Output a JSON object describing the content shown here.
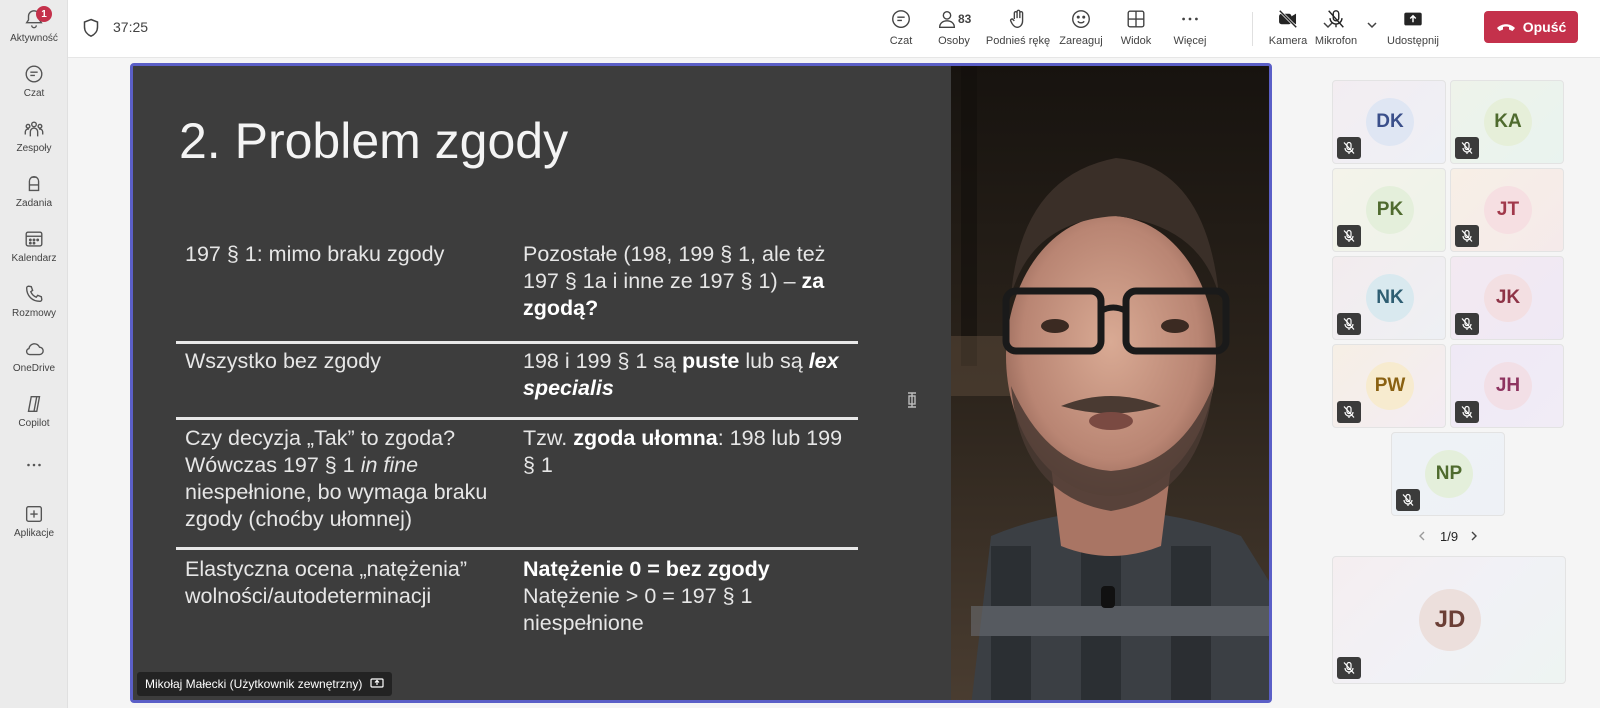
{
  "rail": {
    "items": [
      {
        "label": "Aktywność",
        "icon": "bell-icon",
        "badge": "1"
      },
      {
        "label": "Czat",
        "icon": "chat-icon"
      },
      {
        "label": "Zespoły",
        "icon": "teams-icon"
      },
      {
        "label": "Zadania",
        "icon": "tasks-icon"
      },
      {
        "label": "Kalendarz",
        "icon": "calendar-icon"
      },
      {
        "label": "Rozmowy",
        "icon": "phone-icon"
      },
      {
        "label": "OneDrive",
        "icon": "cloud-icon"
      },
      {
        "label": "Copilot",
        "icon": "copilot-icon"
      },
      {
        "label": "",
        "icon": "more-icon"
      },
      {
        "label": "Aplikacje",
        "icon": "plus-icon"
      }
    ]
  },
  "topbar": {
    "timer": "37:25",
    "chat": "Czat",
    "people": "Osoby",
    "people_count": "83",
    "raise": "Podnieś rękę",
    "react": "Zareaguj",
    "view": "Widok",
    "more": "Więcej",
    "camera": "Kamera",
    "mic": "Mikrofon",
    "share": "Udostępnij",
    "leave": "Opuść"
  },
  "slide": {
    "title": "2. Problem zgody",
    "r1_left": "197 § 1: mimo braku zgody",
    "r1_right_a": "Pozostałe (198, 199 § 1, ale też 197 § 1a i inne ze 197 § 1) –",
    "r1_right_b": "za zgodą?",
    "r2_left": "Wszystko bez zgody",
    "r2_right_a": "198 i 199 § 1 są",
    "r2_right_b": "puste",
    "r2_right_c": "lub są",
    "r2_right_d": "lex specialis",
    "r3_left_a": "Czy decyzja „Tak” to zgoda? Wówczas 197 § 1",
    "r3_left_b": "in fine",
    "r3_left_c": "niespełnione, bo wymaga braku zgody (choćby ułomnej)",
    "r3_right_a": "Tzw.",
    "r3_right_b": "zgoda ułomna",
    "r3_right_c": ": 198 lub 199 § 1",
    "r4_left": "Elastyczna ocena „natężenia” wolności/autodeterminacji",
    "r4_right_a": "Natężenie 0 = bez zgody",
    "r4_right_b": "Natężenie > 0 = 197 § 1 niespełnione"
  },
  "presenter": {
    "name": "Mikołaj Małecki (Użytkownik zewnętrzny)"
  },
  "roster": {
    "tiles": [
      {
        "initials": "DK",
        "color": "#dfe6f3",
        "text": "#3a4f8a"
      },
      {
        "initials": "KA",
        "color": "#e6efd9",
        "text": "#4f6b2e"
      },
      {
        "initials": "PK",
        "color": "#e4efdb",
        "text": "#4f6b2e"
      },
      {
        "initials": "JT",
        "color": "#f6dfe2",
        "text": "#a1394b"
      },
      {
        "initials": "NK",
        "color": "#d9e9ef",
        "text": "#2e5e72"
      },
      {
        "initials": "JK",
        "color": "#f3dfe2",
        "text": "#8e3447"
      },
      {
        "initials": "PW",
        "color": "#f7ebcf",
        "text": "#8a6112"
      },
      {
        "initials": "JH",
        "color": "#f2dfe6",
        "text": "#8e3460"
      },
      {
        "initials": "NP",
        "color": "#e4efdb",
        "text": "#4f6b2e"
      }
    ],
    "pager": "1/9",
    "big": {
      "initials": "JD",
      "color": "#ecdfdc",
      "text": "#6b3f36"
    }
  }
}
